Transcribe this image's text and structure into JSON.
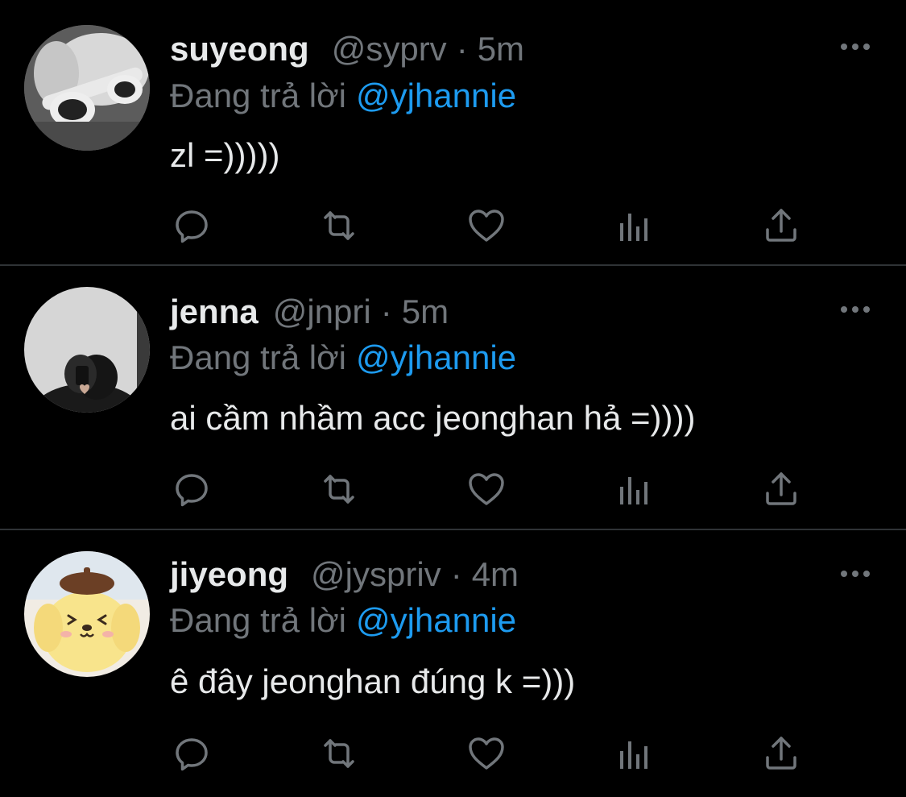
{
  "reply_prefix": "Đang trả lời",
  "tweets": [
    {
      "name": "suyeong",
      "handle": "@syprv",
      "separator": "·",
      "time": "5m",
      "mention": "@yjhannie",
      "text": "zl =)))))",
      "avatar": "avatar-white-sunglasses"
    },
    {
      "name": "jenna",
      "handle": "@jnpri",
      "separator": "·",
      "time": "5m",
      "mention": "@yjhannie",
      "text": "ai cầm nhầm acc jeonghan hả =))))",
      "avatar": "avatar-girl-mirror-selfie"
    },
    {
      "name": "jiyeong",
      "handle": "@jyspriv",
      "separator": "·",
      "time": "4m",
      "mention": "@yjhannie",
      "text": "ê đây jeonghan đúng k =)))",
      "avatar": "avatar-pompompurin"
    }
  ],
  "colors": {
    "background": "#000000",
    "text": "#e7e9ea",
    "muted": "#71767b",
    "accent": "#1d9bf0",
    "divider": "#2f3336"
  },
  "icons": [
    "more-icon",
    "reply-icon",
    "retweet-icon",
    "like-icon",
    "views-icon",
    "share-icon"
  ]
}
